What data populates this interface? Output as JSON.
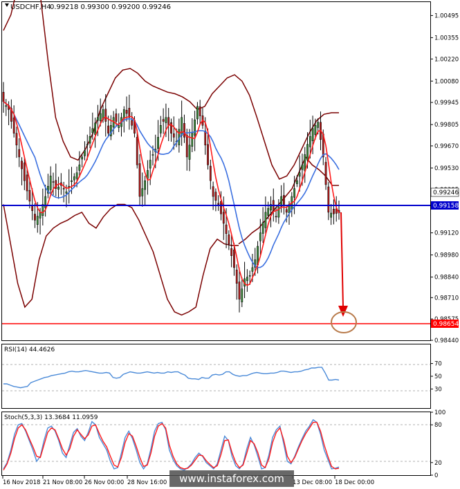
{
  "header": {
    "symbol_label": "USDCHF,H4",
    "ohlc_label": "0.99218 0.99300 0.99200 0.99246",
    "rsi_label": "RSI(14) 44.4626",
    "stoch_label": "Stoch(5,3,3) 13.3684 11.0959",
    "watermark": "www.instaforex.com"
  },
  "colors": {
    "background": "#ffffff",
    "bull_candle": "#3a8a3a",
    "bear_candle": "#b01818",
    "bollinger": "#7a0000",
    "ma_fast": "#ff1a1a",
    "ma_slow": "#3a6fe0",
    "support_line": "#0000cc",
    "target_line": "#ff0000",
    "arrow": "#e00000",
    "target_circle": "#b87a4a",
    "price_badge": "#ffffff",
    "support_badge": "#0000cc",
    "target_badge": "#ff0000",
    "rsi_line": "#4a8ad8",
    "stoch_main": "#4a8ad8",
    "stoch_signal": "#ff1a1a",
    "watermark_bg": "#4d4d4d"
  },
  "chart_data": [
    {
      "type": "candlestick",
      "panel": "price",
      "ylim": [
        0.9844,
        1.0058
      ],
      "y_ticks": [
        "1.00495",
        "1.00355",
        "1.00220",
        "1.00080",
        "0.99945",
        "0.99805",
        "0.99670",
        "0.99530",
        "0.99395",
        "0.99120",
        "0.98980",
        "0.98840",
        "0.98710",
        "0.98575",
        "0.98440"
      ],
      "last_price": "0.99246",
      "support_level": "0.99158",
      "target_level": "0.98654",
      "x_tick_labels": [
        "16 Nov 2018",
        "21 Nov 08:00",
        "26 Nov 00:00",
        "28 Nov 16:00",
        "13 Dec 08:00",
        "18 Dec 00:00"
      ],
      "close_path": [
        0.9995,
        0.999,
        0.9975,
        0.996,
        0.9945,
        0.9932,
        0.992,
        0.9925,
        0.9935,
        0.9948,
        0.994,
        0.9942,
        0.9938,
        0.9945,
        0.995,
        0.996,
        0.9968,
        0.9978,
        0.9985,
        0.999,
        0.9975,
        0.9985,
        0.998,
        0.999,
        0.9985,
        0.9975,
        0.9935,
        0.9945,
        0.9958,
        0.9965,
        0.998,
        0.9985,
        0.9975,
        0.997,
        0.9985,
        0.996,
        0.9975,
        0.9992,
        0.998,
        0.9955,
        0.9935,
        0.993,
        0.9918,
        0.9905,
        0.989,
        0.987,
        0.9883,
        0.9885,
        0.9895,
        0.9912,
        0.9925,
        0.993,
        0.9922,
        0.9935,
        0.9925,
        0.9935,
        0.9945,
        0.9955,
        0.9968,
        0.9978,
        0.9982,
        0.996,
        0.9925,
        0.9924,
        0.99246
      ],
      "bb_upper": [
        1.004,
        1.005,
        1.007,
        1.009,
        1.0085,
        1.006,
        1.002,
        0.9985,
        0.997,
        0.996,
        0.9958,
        0.9965,
        0.9975,
        0.999,
        1.0,
        1.001,
        1.0015,
        1.0016,
        1.0013,
        1.0008,
        1.0005,
        1.0003,
        1.0001,
        1.0,
        0.9998,
        0.9995,
        0.999,
        0.9992,
        1.0,
        1.0005,
        1.001,
        1.0012,
        1.0008,
        0.9999,
        0.9985,
        0.997,
        0.9955,
        0.9946,
        0.9948,
        0.9955,
        0.9965,
        0.9975,
        0.9983,
        0.9987,
        0.9988,
        0.9988
      ],
      "bb_lower": [
        0.993,
        0.9905,
        0.988,
        0.9865,
        0.987,
        0.9895,
        0.991,
        0.9915,
        0.9918,
        0.992,
        0.9923,
        0.9925,
        0.9918,
        0.9915,
        0.9922,
        0.9927,
        0.993,
        0.993,
        0.9928,
        0.992,
        0.991,
        0.99,
        0.9885,
        0.987,
        0.9862,
        0.986,
        0.9862,
        0.9865,
        0.9885,
        0.9902,
        0.9908,
        0.9905,
        0.9904,
        0.9904
      ],
      "bb_lower_right": [
        0.9905,
        0.9908,
        0.9912,
        0.9915,
        0.992,
        0.9925,
        0.993,
        0.9935,
        0.994,
        0.995,
        0.996,
        0.9955,
        0.9952,
        0.9948,
        0.9942,
        0.9942
      ]
    },
    {
      "type": "line",
      "panel": "rsi",
      "ylim": [
        0,
        100
      ],
      "y_ticks": [
        "70",
        "50",
        "30"
      ],
      "values": [
        38,
        38,
        36,
        34,
        33,
        32,
        33,
        34,
        40,
        42,
        44,
        46,
        48,
        49,
        51,
        52,
        53,
        54,
        55,
        57,
        58,
        57,
        57,
        58,
        59,
        58,
        57,
        56,
        55,
        55,
        56,
        55,
        48,
        47,
        48,
        53,
        55,
        57,
        56,
        55,
        55,
        56,
        57,
        56,
        55,
        56,
        55,
        55,
        57,
        56,
        57,
        57,
        54,
        52,
        47,
        46,
        46,
        45,
        48,
        47,
        47,
        52,
        53,
        52,
        53,
        57,
        57,
        53,
        51,
        50,
        51,
        51,
        53,
        55,
        56,
        55,
        54,
        54,
        55,
        55,
        56,
        58,
        58,
        57,
        56,
        57,
        57,
        58,
        60,
        61,
        63,
        63,
        64,
        64,
        55,
        44,
        44,
        45,
        44
      ]
    },
    {
      "type": "line",
      "panel": "stochastic",
      "ylim": [
        0,
        100
      ],
      "y_ticks": [
        "100",
        "80",
        "20",
        "0"
      ],
      "main": [
        10,
        20,
        40,
        65,
        80,
        82,
        70,
        55,
        40,
        22,
        30,
        55,
        75,
        78,
        70,
        55,
        35,
        28,
        48,
        68,
        74,
        62,
        55,
        68,
        85,
        80,
        60,
        50,
        40,
        22,
        10,
        12,
        35,
        60,
        70,
        58,
        40,
        20,
        10,
        18,
        42,
        70,
        82,
        84,
        72,
        40,
        25,
        15,
        10,
        8,
        12,
        18,
        28,
        35,
        30,
        20,
        15,
        10,
        18,
        40,
        62,
        55,
        30,
        15,
        10,
        18,
        42,
        60,
        48,
        30,
        10,
        12,
        32,
        60,
        72,
        78,
        50,
        22,
        18,
        30,
        45,
        58,
        70,
        78,
        88,
        84,
        65,
        40,
        25,
        10,
        11,
        13
      ],
      "signal": [
        8,
        18,
        35,
        58,
        75,
        80,
        72,
        58,
        45,
        30,
        28,
        48,
        68,
        75,
        72,
        58,
        42,
        32,
        42,
        62,
        72,
        65,
        58,
        64,
        78,
        80,
        66,
        54,
        45,
        30,
        16,
        13,
        28,
        52,
        66,
        62,
        46,
        28,
        14,
        16,
        35,
        62,
        78,
        82,
        75,
        48,
        30,
        18,
        12,
        10,
        11,
        16,
        24,
        32,
        31,
        23,
        17,
        12,
        15,
        33,
        55,
        56,
        36,
        20,
        12,
        16,
        35,
        55,
        50,
        36,
        16,
        12,
        26,
        52,
        68,
        75,
        56,
        30,
        20,
        28,
        42,
        55,
        66,
        75,
        84,
        84,
        70,
        48,
        30,
        14,
        10,
        11
      ]
    }
  ]
}
